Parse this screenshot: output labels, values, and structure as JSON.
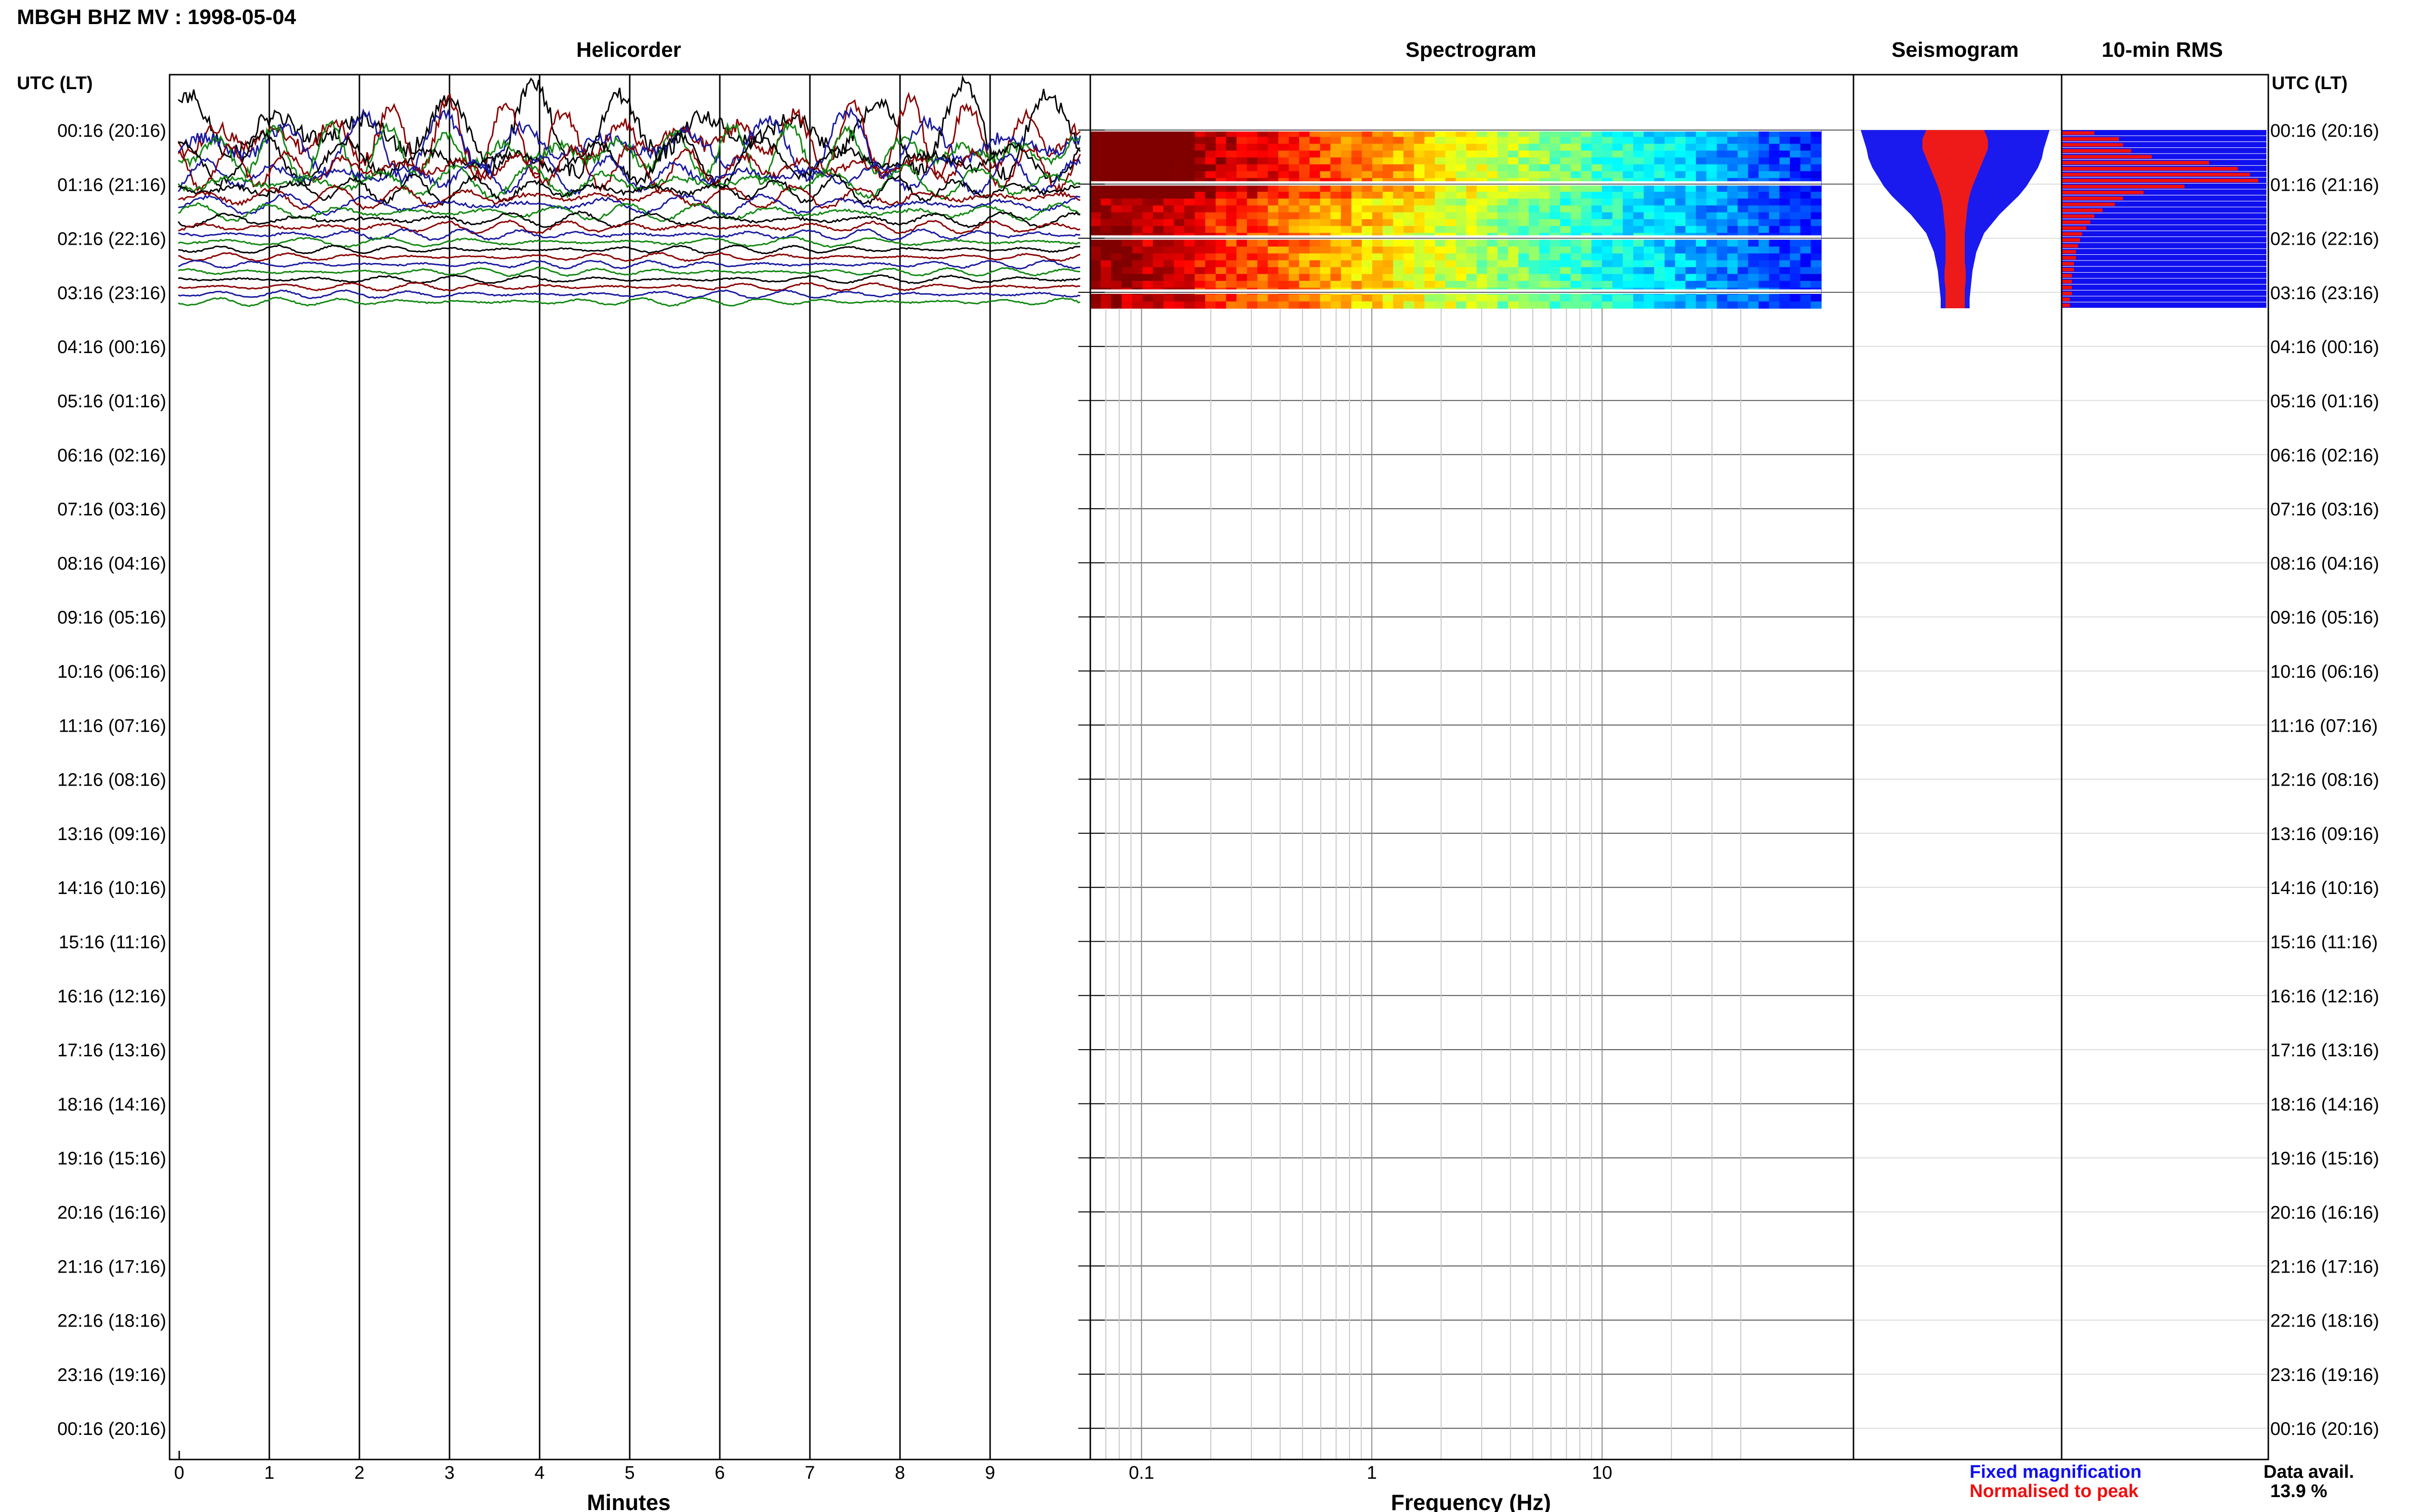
{
  "page": {
    "title": "MBGH BHZ MV : 1998-05-04"
  },
  "panels": {
    "helicorder_title": "Helicorder",
    "spectrogram_title": "Spectrogram",
    "seismogram_title": "Seismogram",
    "rms_title": "10-min RMS"
  },
  "axes": {
    "left_header": "UTC (LT)",
    "right_header": "UTC (LT)",
    "row_labels": [
      "00:16 (20:16)",
      "01:16 (21:16)",
      "02:16 (22:16)",
      "03:16 (23:16)",
      "04:16 (00:16)",
      "05:16 (01:16)",
      "06:16 (02:16)",
      "07:16 (03:16)",
      "08:16 (04:16)",
      "09:16 (05:16)",
      "10:16 (06:16)",
      "11:16 (07:16)",
      "12:16 (08:16)",
      "13:16 (09:16)",
      "14:16 (10:16)",
      "15:16 (11:16)",
      "16:16 (12:16)",
      "17:16 (13:16)",
      "18:16 (14:16)",
      "19:16 (15:16)",
      "20:16 (16:16)",
      "21:16 (17:16)",
      "22:16 (18:16)",
      "23:16 (19:16)",
      "00:16 (20:16)"
    ],
    "minutes_ticks": [
      "0",
      "1",
      "2",
      "3",
      "4",
      "5",
      "6",
      "7",
      "8",
      "9"
    ],
    "minutes_label": "Minutes",
    "freq_ticks": [
      "0.1",
      "1",
      "10"
    ],
    "freq_label": "Frequency (Hz)"
  },
  "legend": {
    "fixed": "Fixed magnification",
    "normalised": "Normalised to peak",
    "fixed_color": "#1010ee",
    "normalised_color": "#ee1010"
  },
  "availability": {
    "label": "Data avail.",
    "value": "13.9 %"
  },
  "chart_data": {
    "type": "heatmap",
    "title": "MBGH BHZ MV : 1998-05-04",
    "xlabel_helicorder": "Minutes",
    "xlabel_spectrogram": "Frequency (Hz)",
    "helicorder_xlim": [
      0,
      10
    ],
    "spectrogram_xlim_hz": [
      0.03,
      40
    ],
    "spectrogram_xscale": "log",
    "data_hours_from_start": [
      0,
      3.3
    ],
    "trace_colors": [
      "#000000",
      "#8b0000",
      "#1a1aa0",
      "#118811"
    ],
    "rms_normalised_10min": [
      0.16,
      0.28,
      0.3,
      0.34,
      0.44,
      0.72,
      0.86,
      0.92,
      0.96,
      0.6,
      0.4,
      0.3,
      0.26,
      0.2,
      0.16,
      0.14,
      0.12,
      0.1,
      0.09,
      0.08,
      0.07,
      0.07,
      0.06,
      0.06,
      0.05,
      0.05,
      0.05,
      0.05,
      0.04,
      0.04
    ],
    "rms_fixed_10min": [
      1,
      1,
      1,
      1,
      1,
      1,
      1,
      1,
      1,
      1,
      1,
      1,
      1,
      1,
      1,
      1,
      1,
      1,
      1,
      1,
      1,
      1,
      1,
      1,
      1,
      1,
      1,
      1,
      1,
      1
    ],
    "seismogram_fixed_halfwidth": [
      0.98,
      0.95,
      0.92,
      0.9,
      0.86,
      0.8,
      0.74,
      0.66,
      0.56,
      0.46,
      0.38,
      0.3,
      0.26,
      0.22,
      0.2,
      0.18,
      0.17,
      0.16,
      0.15,
      0.15
    ],
    "seismogram_norm_halfwidth": [
      0.3,
      0.34,
      0.34,
      0.3,
      0.26,
      0.22,
      0.18,
      0.15,
      0.13,
      0.12,
      0.11,
      0.1,
      0.1,
      0.1,
      0.1,
      0.11,
      0.11,
      0.1,
      0.1,
      0.1
    ],
    "grid": true
  }
}
